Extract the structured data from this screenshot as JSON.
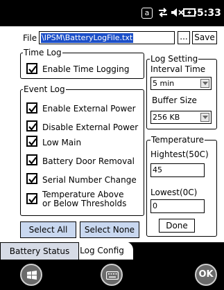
{
  "status_bar": {
    "a_indicator": "a",
    "time": "5:33",
    "icons": [
      "sync-arrows-icon",
      "speaker-muted-icon",
      "battery-charging-icon"
    ]
  },
  "file": {
    "label": "File",
    "value": "\\IPSM\\BatteryLogFile.txt",
    "browse_label": "...",
    "save_label": "Save"
  },
  "time_log": {
    "title": "Time Log",
    "enable_label": "Enable Time Logging",
    "enable_checked": true
  },
  "event_log": {
    "title": "Event Log",
    "items": [
      {
        "label": "Enable External Power",
        "checked": true
      },
      {
        "label": "Disable External Power",
        "checked": true
      },
      {
        "label": "Low Main",
        "checked": true
      },
      {
        "label": "Battery Door Removal",
        "checked": true
      },
      {
        "label": "Serial Number Change",
        "checked": true
      },
      {
        "label": "Temperature Above",
        "label2": "or Below Thresholds",
        "checked": true
      }
    ]
  },
  "log_setting": {
    "title": "Log Setting",
    "interval_label": "Interval Time",
    "interval_value": "5 min",
    "buffer_label": "Buffer Size",
    "buffer_value": "256 KB"
  },
  "temperature": {
    "title": "Temperature",
    "highest_label": "Hightest(50C)",
    "highest_value": "45",
    "lowest_label": "Lowest(0C)",
    "lowest_value": "0",
    "done_label": "Done"
  },
  "actions": {
    "select_all": "Select All",
    "select_none": "Select None"
  },
  "tabs": [
    {
      "label": "Battery Status",
      "active": false
    },
    {
      "label": "Log Config",
      "active": true
    }
  ],
  "bottom_bar": {
    "ok_label": "OK",
    "icons": [
      "windows-start-icon",
      "keyboard-icon"
    ]
  }
}
